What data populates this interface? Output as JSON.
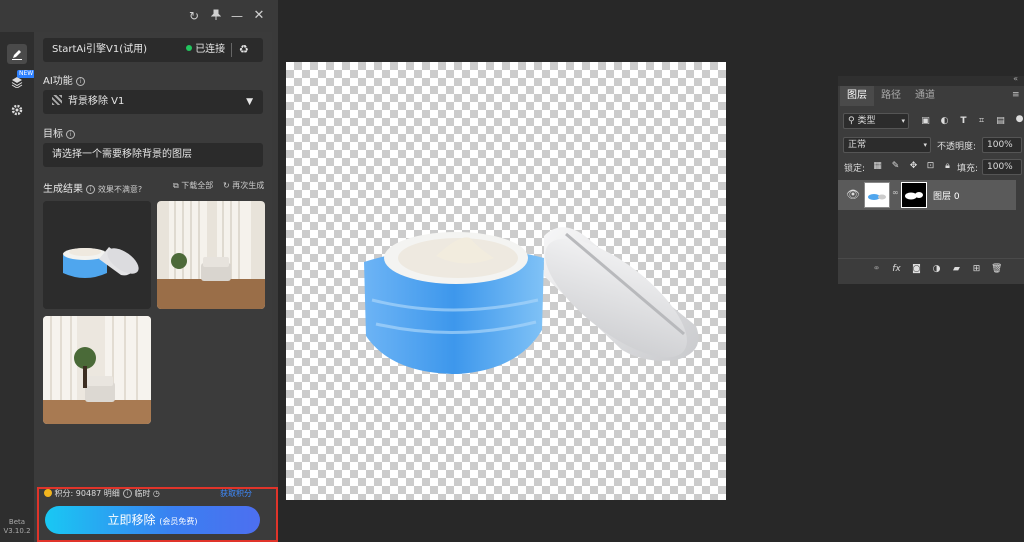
{
  "plugin": {
    "engine_label": "StartAi引擎V1(试用)",
    "status_text": "已连接",
    "status_color": "#22c55e",
    "ai_function_label": "AI功能",
    "ai_function_value": "背景移除 V1",
    "target_label": "目标",
    "target_value": "请选择一个需要移除背景的图层",
    "results_label": "生成结果",
    "feedback_link": "效果不满意?",
    "download_all": "下载全部",
    "regenerate": "再次生成",
    "points_label": "积分:",
    "points_value": "90487",
    "points_extra1": "明细",
    "points_extra2": "临时",
    "get_points_link": "获取积分",
    "action_button": "立即移除",
    "action_button_sub": "(会员免费)",
    "beta_label": "Beta",
    "version_label": "V3.10.2",
    "accent_color": "#2b7fff",
    "new_badge": "NEW"
  },
  "layers_panel": {
    "tabs": [
      "图层",
      "路径",
      "通道"
    ],
    "filter_kind": "类型",
    "blend_mode": "正常",
    "opacity_label": "不透明度:",
    "opacity_value": "100%",
    "lock_label": "锁定:",
    "fill_label": "填充:",
    "fill_value": "100%",
    "layer_name": "图层 0"
  }
}
